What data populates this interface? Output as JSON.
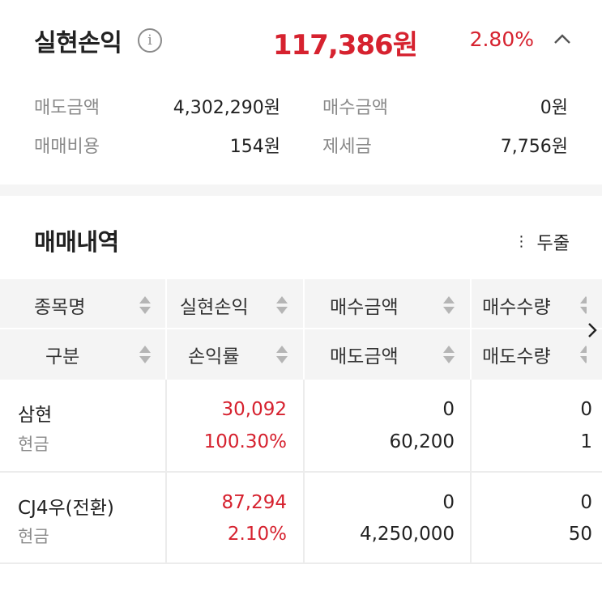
{
  "summary": {
    "title": "실현손익",
    "info_icon": "info-icon",
    "amount": "117,386원",
    "rate": "2.80%",
    "collapse_icon": "chevron-up-icon",
    "colors": {
      "profit": "#d6222f",
      "label": "#8a8a8a"
    },
    "items": [
      {
        "label": "매도금액",
        "value": "4,302,290원"
      },
      {
        "label": "매수금액",
        "value": "0원"
      },
      {
        "label": "매매비용",
        "value": "154원"
      },
      {
        "label": "제세금",
        "value": "7,756원"
      }
    ]
  },
  "history": {
    "title": "매매내역",
    "two_line_label": "두줄",
    "two_line_icon": "vertical-dots-icon"
  },
  "table": {
    "header_row1": [
      "종목명",
      "실현손익",
      "매수금액",
      "매수수량"
    ],
    "header_row2": [
      "구분",
      "손익률",
      "매도금액",
      "매도수량"
    ],
    "sort_icon": "sort-icon",
    "scroll_icon": "chevron-right-icon",
    "rows": [
      {
        "name": "삼현",
        "type": "현금",
        "realized": "30,092",
        "rate": "100.30%",
        "buy_amount": "0",
        "sell_amount": "60,200",
        "buy_qty": "0",
        "sell_qty": "1"
      },
      {
        "name": "CJ4우(전환)",
        "type": "현금",
        "realized": "87,294",
        "rate": "2.10%",
        "buy_amount": "0",
        "sell_amount": "4,250,000",
        "buy_qty": "0",
        "sell_qty": "50"
      }
    ]
  }
}
